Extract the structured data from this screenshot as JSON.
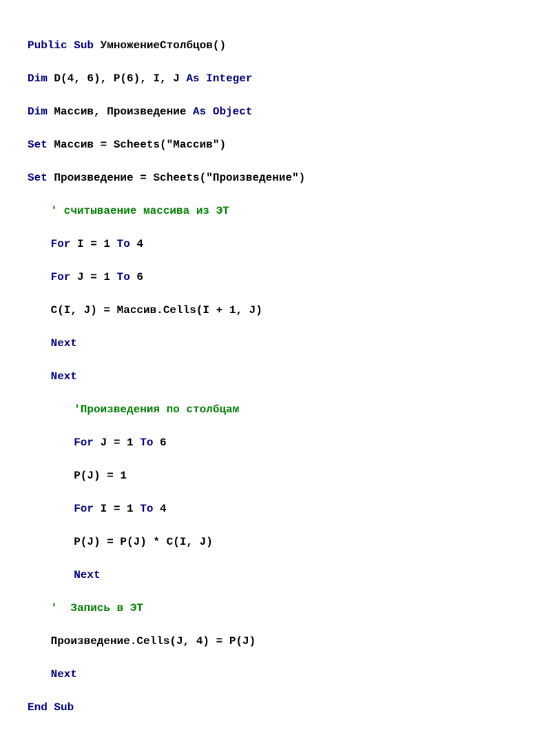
{
  "code": {
    "l1_kw1": "Public Sub",
    "l1_tx1": " УмножениеСтолбцов()",
    "l2_kw1": "Dim",
    "l2_tx1": " D(4, 6), P(6), I, J ",
    "l2_kw2": "As Integer",
    "l3_kw1": "Dim",
    "l3_tx1": " Массив, Произведение ",
    "l3_kw2": "As Object",
    "l4_kw1": "Set",
    "l4_tx1": " Массив = Scheets(\"Массив\")",
    "l5_kw1": "Set",
    "l5_tx1": " Произведение = Scheets(\"Произведение\")",
    "l6_cm1": "' считываение массива из ЭТ",
    "l7_kw1": "For",
    "l7_tx1": " I = 1 ",
    "l7_kw2": "To",
    "l7_tx2": " 4",
    "l8_kw1": "For",
    "l8_tx1": " J = 1 ",
    "l8_kw2": "To",
    "l8_tx2": " 6",
    "l9_tx1": "C(I, J) = Массив.Cells(I + 1, J)",
    "l10_kw1": "Next",
    "l11_kw1": "Next",
    "l12_cm1": "'Произведения по столбцам",
    "l13_kw1": "For",
    "l13_tx1": " J = 1 ",
    "l13_kw2": "To",
    "l13_tx2": " 6",
    "l14_tx1": "P(J) = 1",
    "l15_kw1": "For",
    "l15_tx1": " I = 1 ",
    "l15_kw2": "To",
    "l15_tx2": " 4",
    "l16_tx1": "P(J) = P(J) * C(I, J)",
    "l17_kw1": "Next",
    "l18_cm1": "'  Запись в ЭТ",
    "l19_tx1": "Произведение.Cells(J, 4) = P(J)",
    "l20_kw1": "Next",
    "l21_kw1": "End Sub"
  }
}
